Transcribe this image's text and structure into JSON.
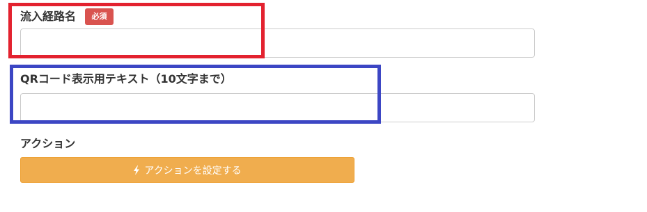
{
  "form": {
    "route_name": {
      "label": "流入経路名",
      "required_badge": "必須",
      "value": ""
    },
    "qr_text": {
      "label": "QRコード表示用テキスト（10文字まで）",
      "value": ""
    },
    "action": {
      "label": "アクション",
      "button_label": "アクションを設定する",
      "button_icon": "lightning-bolt-icon"
    }
  },
  "colors": {
    "badge": "#d9534f",
    "button": "#f0ad4e",
    "highlight_red": "#e3222f",
    "highlight_blue": "#3c46c4"
  }
}
